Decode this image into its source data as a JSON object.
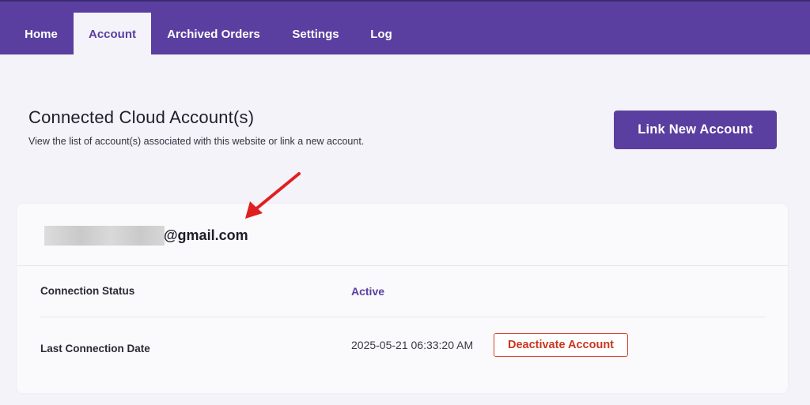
{
  "nav": {
    "tabs": [
      {
        "label": "Home",
        "active": false
      },
      {
        "label": "Account",
        "active": true
      },
      {
        "label": "Archived Orders",
        "active": false
      },
      {
        "label": "Settings",
        "active": false
      },
      {
        "label": "Log",
        "active": false
      }
    ]
  },
  "header": {
    "title": "Connected Cloud Account(s)",
    "subtitle": "View the list of account(s) associated with this website or link a new account.",
    "link_button_label": "Link New Account"
  },
  "account": {
    "email_domain": "@gmail.com",
    "email_local_redacted": true,
    "status_label": "Connection Status",
    "status_value": "Active",
    "date_label": "Last Connection Date",
    "date_value": "2025-05-21 06:33:20 AM",
    "deactivate_label": "Deactivate Account"
  },
  "colors": {
    "brand": "#5a3fa0",
    "danger": "#c8361f",
    "annotation_arrow": "#e02020"
  },
  "icons": {
    "annotation": "red-arrow-icon"
  }
}
